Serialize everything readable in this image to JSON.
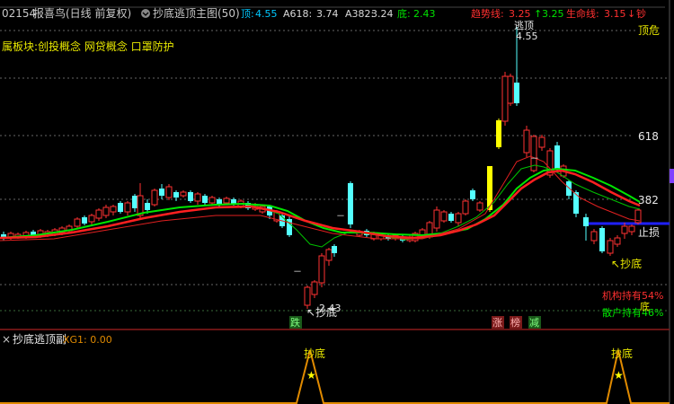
{
  "header": {
    "code": "02154",
    "name": "报喜鸟(日线 前复权)",
    "indicator": "抄底逃顶主图(50)",
    "top_label": "顶:",
    "top_value": "4.55",
    "a618_label": "A618:",
    "a618_value": "3.74",
    "a382_label": "A382:",
    "a382_value": "3.24",
    "bottom_label": "底:",
    "bottom_value": "2.43",
    "trend_label": "趋势线:",
    "trend_value1": "3.25",
    "trend_value2": "3.25",
    "life_label": "生命线:",
    "life_value": "3.15",
    "extra": "钞"
  },
  "concepts": "属板块:创投概念 网贷概念 口罩防护",
  "levels": {
    "top": "顶危",
    "l618": "618",
    "l382": "382",
    "stop": "止损",
    "bottom": "底"
  },
  "annotations": {
    "peak_prefix": "逃顶",
    "peak_price": "4.55",
    "low_price": "2.43",
    "chaodi_left": "抄底",
    "chaodi_right": "抄底",
    "inst_hold": "机构持有54%",
    "retail_hold": "散户持有46%",
    "sub_right": "底",
    "dash1": "－",
    "dash2": "－",
    "dash3": "－"
  },
  "badges": {
    "fall": "跌",
    "rise": "涨",
    "list": "榜",
    "reduce": "减"
  },
  "sub_panel": {
    "title": "抄底逃顶副",
    "xg_label": "XG1: 0.00",
    "signal1": "抄底",
    "signal2": "抄底",
    "star": "★"
  },
  "colors": {
    "up": "#ff3232",
    "down": "#54ffff",
    "yellow": "#ffff00",
    "green": "#00e600",
    "red_line": "#ff2020",
    "orange": "#e08a00"
  }
}
